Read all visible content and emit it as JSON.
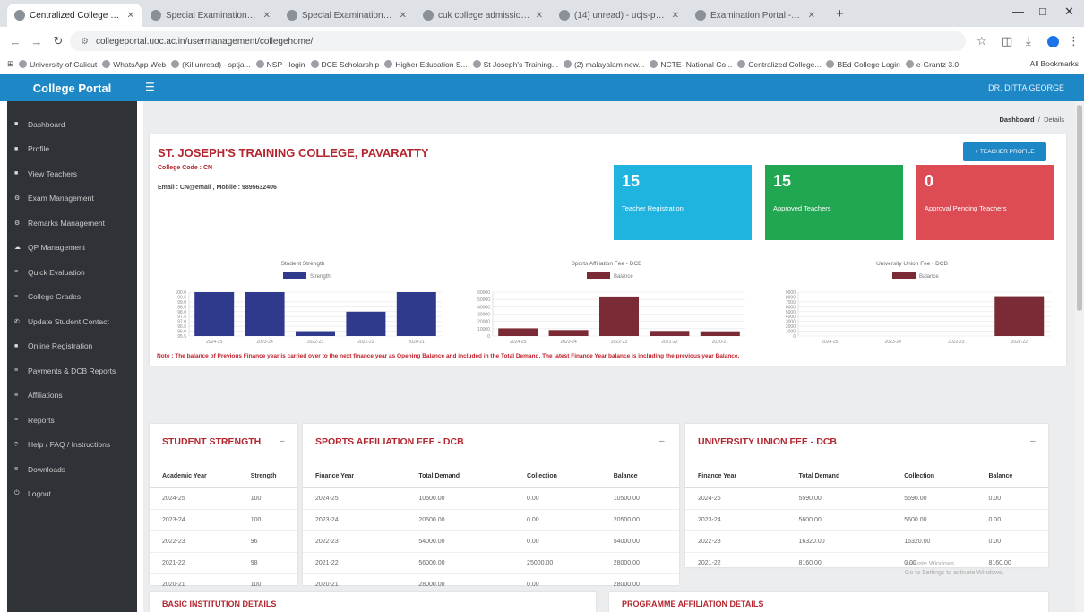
{
  "browser": {
    "tabs": [
      {
        "title": "Centralized College Portal",
        "active": true
      },
      {
        "title": "Special Examination - Mba (10)",
        "active": false
      },
      {
        "title": "Special Examination -Mba (10)",
        "active": false
      },
      {
        "title": "cuk college admission-ucadb",
        "active": false
      },
      {
        "title": "(14) unread) - ucjs-pavaratty",
        "active": false
      },
      {
        "title": "Examination Portal - Core login",
        "active": false
      }
    ],
    "url": "collegeportal.uoc.ac.in/usermanagement/collegehome/",
    "bookmarks": [
      "University of Calicut",
      "WhatsApp Web",
      "(Kil unread) - sptja...",
      "NSP - login",
      "DCE Scholarship",
      "Higher Education S...",
      "St Joseph's Training...",
      "(2) malayalam new...",
      "NCTE- National Co...",
      "Centralized College...",
      "BEd College Login",
      "e-Grantz 3.0"
    ],
    "all_bookmarks": "All Bookmarks"
  },
  "app": {
    "brand": "College Portal",
    "user": "DR. DITTA GEORGE"
  },
  "sidebar": {
    "items": [
      "Dashboard",
      "Profile",
      "View Teachers",
      "Exam Management",
      "Remarks Management",
      "QP Management",
      "Quick Evaluation",
      "College Grades",
      "Update Student Contact",
      "Online Registration",
      "Payments & DCB Reports",
      "Affiliations",
      "Reports",
      "Help / FAQ / Instructions",
      "Downloads",
      "Logout"
    ]
  },
  "breadcrumb": {
    "home": "Dashboard",
    "current": "Details"
  },
  "college": {
    "name": "ST. JOSEPH'S TRAINING COLLEGE, PAVARATTY",
    "code": "College Code : CN",
    "contact": "Email : CN@email , Mobile : 9895632406",
    "profile_button": "+ TEACHER PROFILE"
  },
  "stats": [
    {
      "value": "15",
      "label": "Teacher Registration",
      "color": "#1fb4e0"
    },
    {
      "value": "15",
      "label": "Approved Teachers",
      "color": "#21a652"
    },
    {
      "value": "0",
      "label": "Approval Pending Teachers",
      "color": "#dd4b55"
    }
  ],
  "note": "Note : The balance of Previous Finance year is carried over to the next finance year as Opening Balance and included in the Total Demand. The latest Finance Year balance is including the previous year Balance.",
  "chart_data": [
    {
      "type": "bar",
      "title": "Student Strength",
      "series": [
        {
          "name": "Strength",
          "color": "#303a8c",
          "values": [
            100,
            100,
            96,
            98,
            100
          ]
        }
      ],
      "categories": [
        "2024-25",
        "2023-24",
        "2022-23",
        "2021-22",
        "2020-21"
      ],
      "ylim": [
        95.5,
        100
      ],
      "yticks": [
        "100.0",
        "99.5",
        "99.0",
        "98.5",
        "98.0",
        "97.5",
        "97.0",
        "96.5",
        "96.0",
        "95.5"
      ]
    },
    {
      "type": "bar",
      "title": "Sports Affiliation Fee - DCB",
      "series": [
        {
          "name": "Balance",
          "color": "#7a2b35",
          "values": [
            10500,
            8200,
            54000,
            7000,
            6500
          ]
        }
      ],
      "categories": [
        "2024-25",
        "2023-24",
        "2022-23",
        "2021-22",
        "2020-21"
      ],
      "ylim": [
        0,
        60000
      ],
      "yticks": [
        "60000",
        "50000",
        "40000",
        "30000",
        "20000",
        "10000",
        "0"
      ]
    },
    {
      "type": "bar",
      "title": "University Union Fee - DCB",
      "series": [
        {
          "name": "Balance",
          "color": "#7a2b35",
          "values": [
            0,
            0,
            0,
            8160
          ]
        }
      ],
      "categories": [
        "2024-25",
        "2023-24",
        "2022-23",
        "2021-22"
      ],
      "ylim": [
        0,
        9000
      ],
      "yticks": [
        "9000",
        "8000",
        "7000",
        "6000",
        "5000",
        "4000",
        "3000",
        "2000",
        "1000",
        "0"
      ]
    }
  ],
  "student_strength": {
    "title": "STUDENT STRENGTH",
    "headers": [
      "Academic Year",
      "Strength"
    ],
    "rows": [
      [
        "2024-25",
        "100"
      ],
      [
        "2023-24",
        "100"
      ],
      [
        "2022-23",
        "96"
      ],
      [
        "2021-22",
        "98"
      ],
      [
        "2020-21",
        "100"
      ]
    ]
  },
  "sports_fee": {
    "title": "SPORTS AFFILIATION FEE - DCB",
    "headers": [
      "Finance Year",
      "Total Demand",
      "Collection",
      "Balance"
    ],
    "rows": [
      [
        "2024-25",
        "10500.00",
        "0.00",
        "10500.00"
      ],
      [
        "2023-24",
        "20500.00",
        "0.00",
        "20500.00"
      ],
      [
        "2022-23",
        "54000.00",
        "0.00",
        "54000.00"
      ],
      [
        "2021-22",
        "56000.00",
        "25000.00",
        "28000.00"
      ],
      [
        "2020-21",
        "28000.00",
        "0.00",
        "28000.00"
      ]
    ]
  },
  "union_fee": {
    "title": "UNIVERSITY UNION FEE - DCB",
    "headers": [
      "Finance Year",
      "Total Demand",
      "Collection",
      "Balance"
    ],
    "rows": [
      [
        "2024-25",
        "5590.00",
        "5590.00",
        "0.00"
      ],
      [
        "2023-24",
        "5600.00",
        "5600.00",
        "0.00"
      ],
      [
        "2022-23",
        "16320.00",
        "16320.00",
        "0.00"
      ],
      [
        "2021-22",
        "8160.00",
        "0.00",
        "8160.00"
      ]
    ]
  },
  "bottom_panels": {
    "left": "BASIC INSTITUTION DETAILS",
    "right": "PROGRAMME AFFILIATION DETAILS"
  },
  "watermark": {
    "line1": "Activate Windows",
    "line2": "Go to Settings to activate Windows."
  }
}
